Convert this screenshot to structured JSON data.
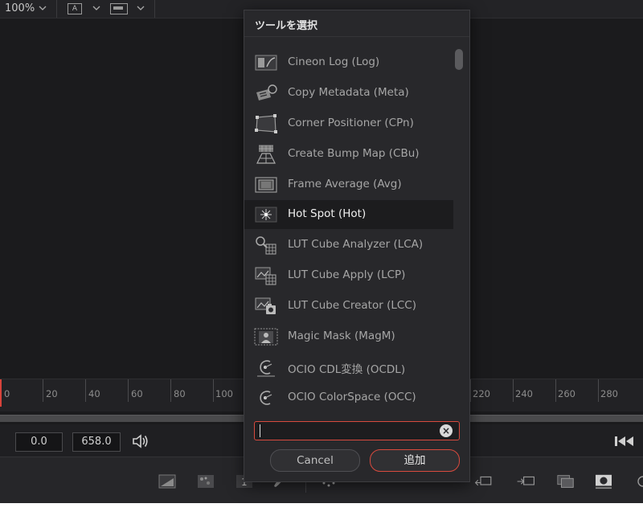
{
  "topbar": {
    "zoom": "100%",
    "view_a_label": "A"
  },
  "ruler": {
    "ticks_left": [
      "0",
      "20",
      "40",
      "60",
      "80",
      "100"
    ],
    "ticks_right": [
      "220",
      "240",
      "260",
      "280"
    ]
  },
  "transport": {
    "current_time": "0.0",
    "end_time": "658.0"
  },
  "dialog": {
    "title": "ツールを選択",
    "items": [
      {
        "label": "Cineon Log (Log)",
        "icon": "cineon-log-icon"
      },
      {
        "label": "Copy Metadata (Meta)",
        "icon": "copy-metadata-icon"
      },
      {
        "label": "Corner Positioner (CPn)",
        "icon": "corner-positioner-icon"
      },
      {
        "label": "Create Bump Map (CBu)",
        "icon": "create-bump-map-icon"
      },
      {
        "label": "Frame Average (Avg)",
        "icon": "frame-average-icon"
      },
      {
        "label": "Hot Spot (Hot)",
        "icon": "hot-spot-icon",
        "selected": true
      },
      {
        "label": "LUT Cube Analyzer (LCA)",
        "icon": "lut-cube-analyzer-icon"
      },
      {
        "label": "LUT Cube Apply (LCP)",
        "icon": "lut-cube-apply-icon"
      },
      {
        "label": "LUT Cube Creator (LCC)",
        "icon": "lut-cube-creator-icon"
      },
      {
        "label": "Magic Mask (MagM)",
        "icon": "magic-mask-icon"
      },
      {
        "label": "OCIO CDL変換 (OCDL)",
        "icon": "ocio-cdl-icon"
      },
      {
        "label": "OCIO ColorSpace (OCC)",
        "icon": "ocio-colorspace-icon"
      }
    ],
    "search_value": "",
    "search_placeholder": "",
    "cancel_label": "Cancel",
    "add_label": "追加"
  },
  "colors": {
    "accent": "#d84a3e",
    "playhead": "#d8433b"
  }
}
